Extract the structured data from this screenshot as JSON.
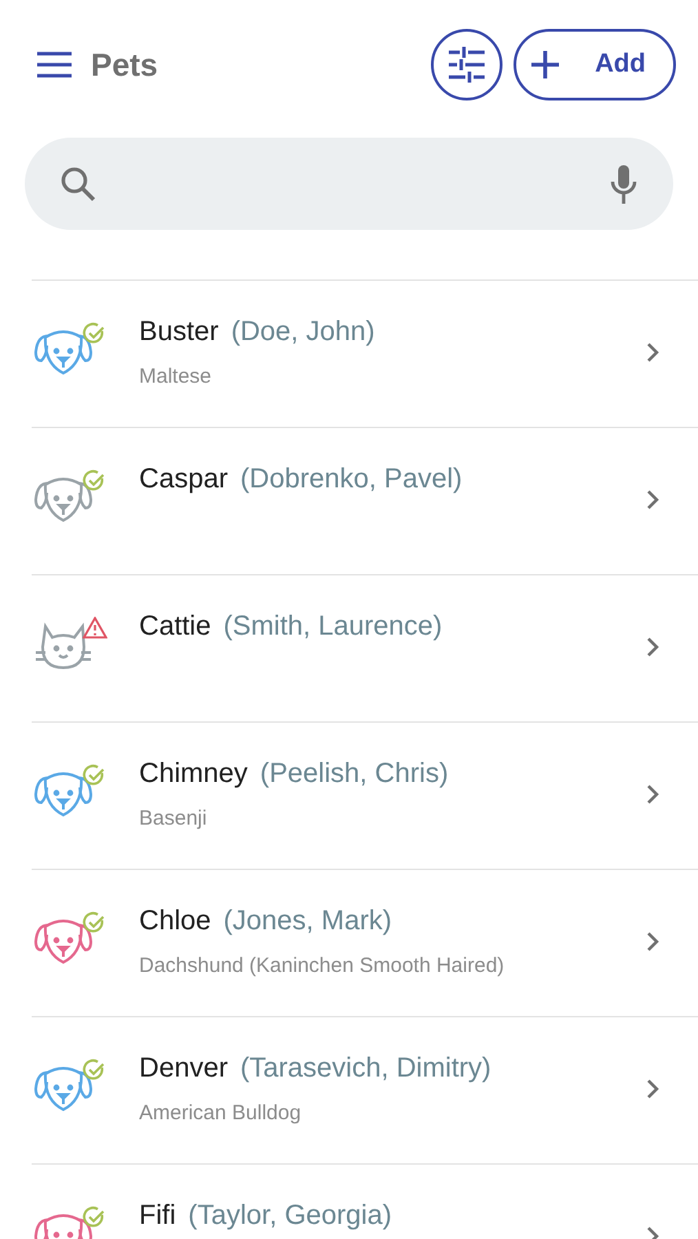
{
  "header": {
    "title": "Pets",
    "add_label": "Add"
  },
  "pets": [
    {
      "name": "Buster",
      "owner": "(Doe, John)",
      "breed": "Maltese",
      "kind": "dog",
      "color": "#5aa9e6",
      "alert": false
    },
    {
      "name": "Caspar",
      "owner": "(Dobrenko, Pavel)",
      "kind": "dog",
      "color": "#9aa3a8",
      "alert": false
    },
    {
      "name": "Cattie",
      "owner": "(Smith, Laurence)",
      "kind": "cat",
      "color": "#9aa3a8",
      "alert": true
    },
    {
      "name": "Chimney",
      "owner": "(Peelish, Chris)",
      "breed": "Basenji",
      "kind": "dog",
      "color": "#5aa9e6",
      "alert": false
    },
    {
      "name": "Chloe",
      "owner": "(Jones, Mark)",
      "breed": "Dachshund (Kaninchen Smooth Haired)",
      "kind": "dog",
      "color": "#e5688e",
      "alert": false
    },
    {
      "name": "Denver",
      "owner": "(Tarasevich, Dimitry)",
      "breed": "American Bulldog",
      "kind": "dog",
      "color": "#5aa9e6",
      "alert": false
    },
    {
      "name": "Fifi",
      "owner": "(Taylor, Georgia)",
      "kind": "dog",
      "color": "#e5688e",
      "alert": false
    }
  ]
}
